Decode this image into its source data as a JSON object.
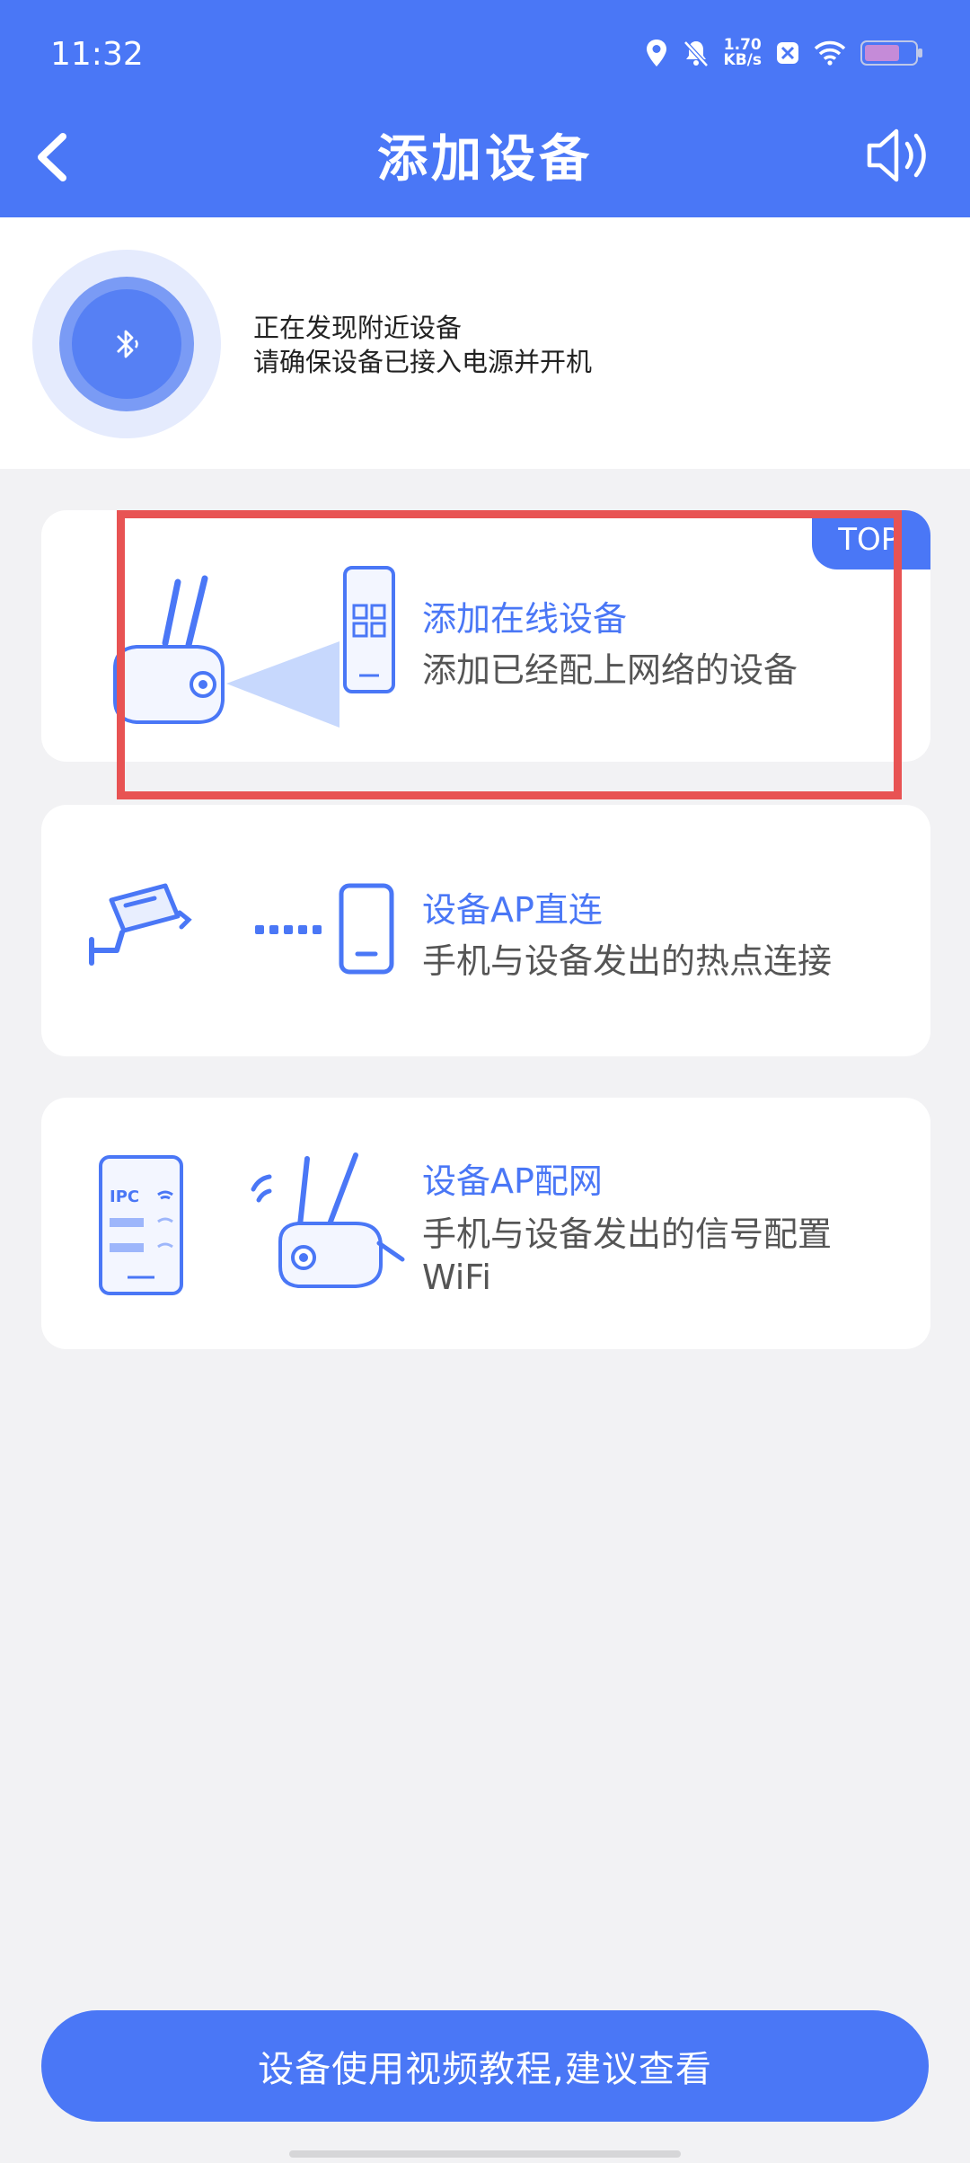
{
  "status_bar": {
    "time": "11:32",
    "speed_value": "1.70",
    "speed_unit": "KB/s",
    "icons": [
      "location-icon",
      "bell-off-icon",
      "app-notification-icon",
      "wifi-icon",
      "battery-icon"
    ]
  },
  "header": {
    "title": "添加设备",
    "back_icon": "chevron-left-icon",
    "sound_icon": "speaker-icon"
  },
  "discover": {
    "line1": "正在发现附近设备",
    "line2": "请确保设备已接入电源并开机",
    "icon": "bluetooth-icon"
  },
  "options": [
    {
      "title": "添加在线设备",
      "desc": "添加已经配上网络的设备",
      "badge": "TOP."
    },
    {
      "title": "设备AP直连",
      "desc": "手机与设备发出的热点连接"
    },
    {
      "title": "设备AP配网",
      "desc": "手机与设备发出的信号配置WiFi"
    }
  ],
  "bottom_button": "设备使用视频教程,建议查看",
  "colors": {
    "brand": "#4a77f6",
    "highlight": "#e85353",
    "background": "#f2f2f4"
  }
}
